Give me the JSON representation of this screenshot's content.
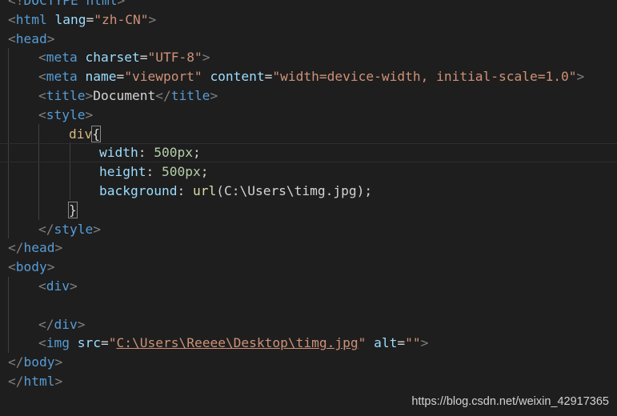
{
  "watermark": "https://blog.csdn.net/weixin_42917365",
  "code": {
    "l1": {
      "bracket_open": "<!",
      "tag": "DOCTYPE",
      "rest": " html",
      "bracket_close": ">"
    },
    "l2": {
      "tag": "html",
      "attr": "lang",
      "value": "\"zh-CN\""
    },
    "l3": {
      "tag": "head"
    },
    "l4": {
      "tag": "meta",
      "attr": "charset",
      "value": "\"UTF-8\""
    },
    "l5": {
      "tag": "meta",
      "attr1": "name",
      "value1": "\"viewport\"",
      "attr2": "content",
      "value2": "\"width=device-width, initial-scale=1.0\""
    },
    "l6": {
      "tag": "title",
      "text": "Document"
    },
    "l7": {
      "tag": "style"
    },
    "l8": {
      "selector": "div",
      "brace": "{"
    },
    "l9": {
      "prop": "width",
      "value": "500px"
    },
    "l10": {
      "prop": "height",
      "value": "500px"
    },
    "l11": {
      "prop": "background",
      "func": "url",
      "arg": "(C:\\Users\\timg.jpg)",
      "end": ";"
    },
    "l12": {
      "brace": "}"
    },
    "l13": {
      "tag": "style"
    },
    "l14": {
      "tag": "head"
    },
    "l15": {
      "tag": "body"
    },
    "l16": {
      "tag": "div"
    },
    "l18": {
      "tag": "div"
    },
    "l19": {
      "tag": "img",
      "attr1": "src",
      "value1": "C:\\Users\\Reeee\\Desktop\\timg.jpg",
      "attr2": "alt",
      "value2": "\"\""
    },
    "l20": {
      "tag": "body"
    },
    "l21": {
      "tag": "html"
    }
  }
}
